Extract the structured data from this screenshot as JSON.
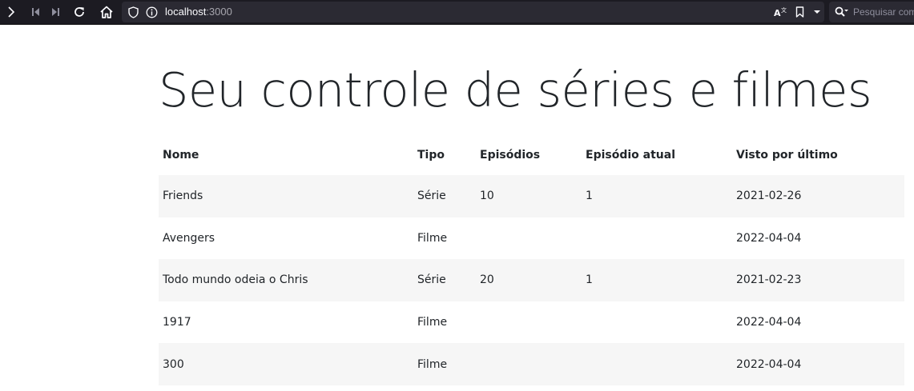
{
  "browser": {
    "url_host": "localhost",
    "url_port": ":3000",
    "search_placeholder": "Pesquisar com Google"
  },
  "page": {
    "title": "Seu controle de séries e filmes"
  },
  "table": {
    "headers": {
      "nome": "Nome",
      "tipo": "Tipo",
      "episodios": "Episódios",
      "episodio_atual": "Episódio atual",
      "visto": "Visto por último"
    },
    "rows": [
      {
        "nome": "Friends",
        "tipo": "Série",
        "episodios": "10",
        "episodio_atual": "1",
        "visto": "2021-02-26"
      },
      {
        "nome": "Avengers",
        "tipo": "Filme",
        "episodios": "",
        "episodio_atual": "",
        "visto": "2022-04-04"
      },
      {
        "nome": "Todo mundo odeia o Chris",
        "tipo": "Série",
        "episodios": "20",
        "episodio_atual": "1",
        "visto": "2021-02-23"
      },
      {
        "nome": "1917",
        "tipo": "Filme",
        "episodios": "",
        "episodio_atual": "",
        "visto": "2022-04-04"
      },
      {
        "nome": "300",
        "tipo": "Filme",
        "episodios": "",
        "episodio_atual": "",
        "visto": "2022-04-04"
      }
    ]
  },
  "icons": {
    "toolbar": [
      "sidebar-expand-icon",
      "first-page-icon",
      "last-page-icon",
      "reload-icon",
      "home-icon",
      "tracking-shield-icon",
      "site-info-icon",
      "translate-icon",
      "bookmark-icon",
      "dropdown-icon",
      "search-icon"
    ]
  }
}
